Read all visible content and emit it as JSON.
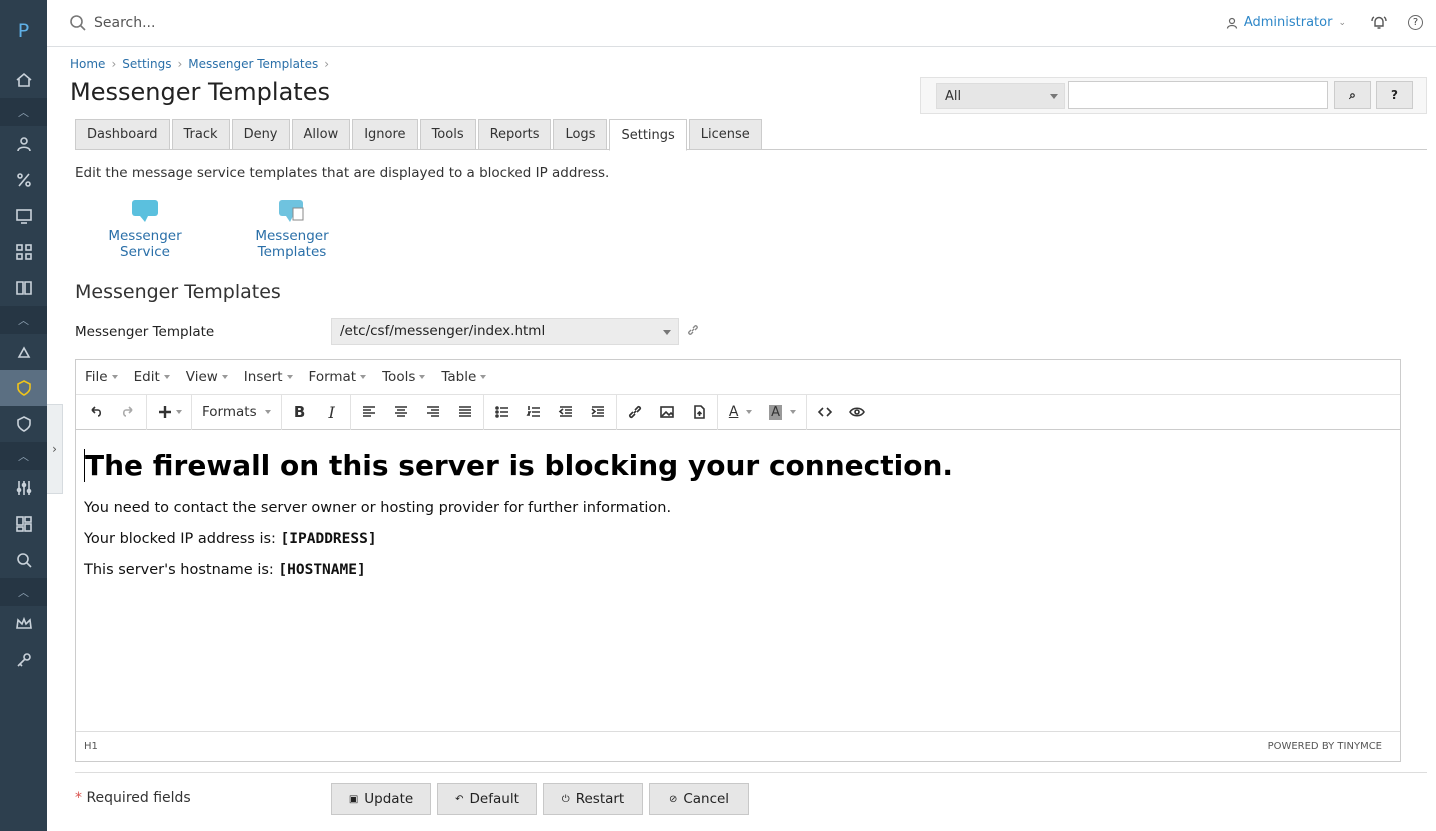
{
  "logo": "P",
  "topbar": {
    "search_placeholder": "Search...",
    "user": "Administrator",
    "help": "?"
  },
  "breadcrumb": [
    "Home",
    "Settings",
    "Messenger Templates"
  ],
  "page_title": "Messenger Templates",
  "search": {
    "filter_value": "All",
    "search_btn": "⌕",
    "help_btn": "?"
  },
  "tabs": [
    "Dashboard",
    "Track",
    "Deny",
    "Allow",
    "Ignore",
    "Tools",
    "Reports",
    "Logs",
    "Settings",
    "License"
  ],
  "active_tab": "Settings",
  "intro": "Edit the message service templates that are displayed to a blocked IP address.",
  "quick_links": {
    "service": "Messenger Service",
    "templates_line1": "Messenger",
    "templates_line2": "Templates"
  },
  "section_title": "Messenger Templates",
  "template_label": "Messenger Template",
  "template_value": "/etc/csf/messenger/index.html",
  "editor": {
    "menu": [
      "File",
      "Edit",
      "View",
      "Insert",
      "Format",
      "Tools",
      "Table"
    ],
    "formats": "Formats",
    "heading": "The firewall on this server is blocking your connection.",
    "p1": "You need to contact the server owner or hosting provider for further information.",
    "p2_prefix": "Your blocked IP address is: ",
    "p2_bold": "[IPADDRESS]",
    "p3_prefix": "This server's hostname is: ",
    "p3_bold": "[HOSTNAME]",
    "status_path": "H1",
    "powered": "POWERED BY TINYMCE"
  },
  "required": "Required fields",
  "required_star": "*",
  "buttons": {
    "update": "Update",
    "default": "Default",
    "restart": "Restart",
    "cancel": "Cancel"
  },
  "colors": {
    "nav_bg": "#2d3f4e",
    "link": "#2a6fa8",
    "user": "#2e87c8"
  }
}
